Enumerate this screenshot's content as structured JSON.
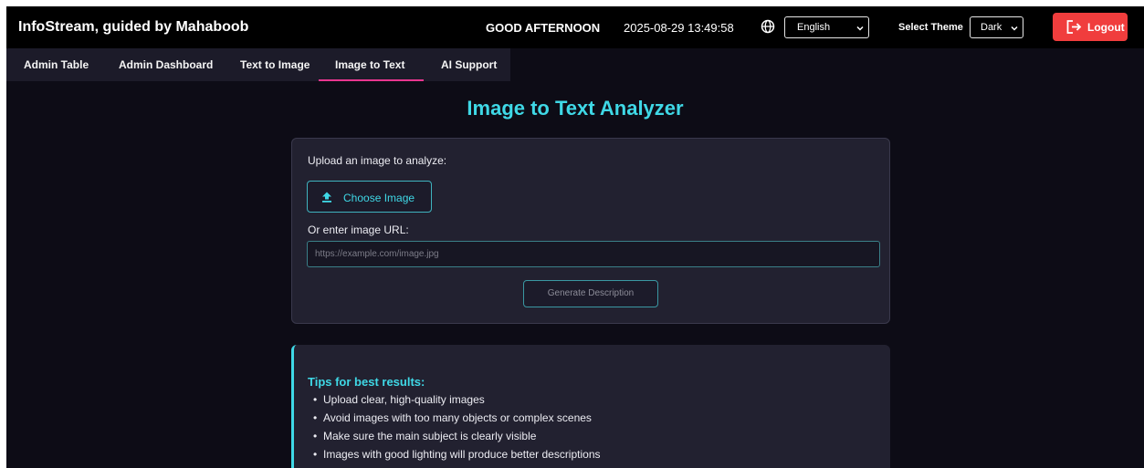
{
  "header": {
    "brand": "InfoStream, guided by Mahaboob",
    "greeting": "GOOD AFTERNOON",
    "datetime": "2025-08-29 13:49:58",
    "language": "English",
    "theme_label": "Select Theme",
    "theme": "Dark",
    "logout_label": "Logout"
  },
  "nav": {
    "tabs": [
      {
        "label": "Admin Table"
      },
      {
        "label": "Admin Dashboard"
      },
      {
        "label": "Text to Image"
      },
      {
        "label": "Image to Text",
        "active": true
      },
      {
        "label": "AI Support"
      }
    ]
  },
  "main": {
    "title": "Image to Text Analyzer",
    "upload_label": "Upload an image to analyze:",
    "choose_button": "Choose Image",
    "url_label": "Or enter image URL:",
    "url_value": "",
    "url_placeholder": "https://example.com/image.jpg",
    "generate_button": "Generate Description"
  },
  "tips": {
    "title": "Tips for best results:",
    "items": [
      "Upload clear, high-quality images",
      "Avoid images with too many objects or complex scenes",
      "Make sure the main subject is clearly visible",
      "Images with good lighting will produce better descriptions"
    ]
  },
  "colors": {
    "accent": "#3fd8e6",
    "logout": "#f03d3d",
    "active_tab_underline": "#e8368f",
    "background": "#0d0c16",
    "card": "#222130"
  },
  "icons": [
    "globe-icon",
    "chevron-down-icon",
    "logout-icon",
    "upload-icon"
  ]
}
